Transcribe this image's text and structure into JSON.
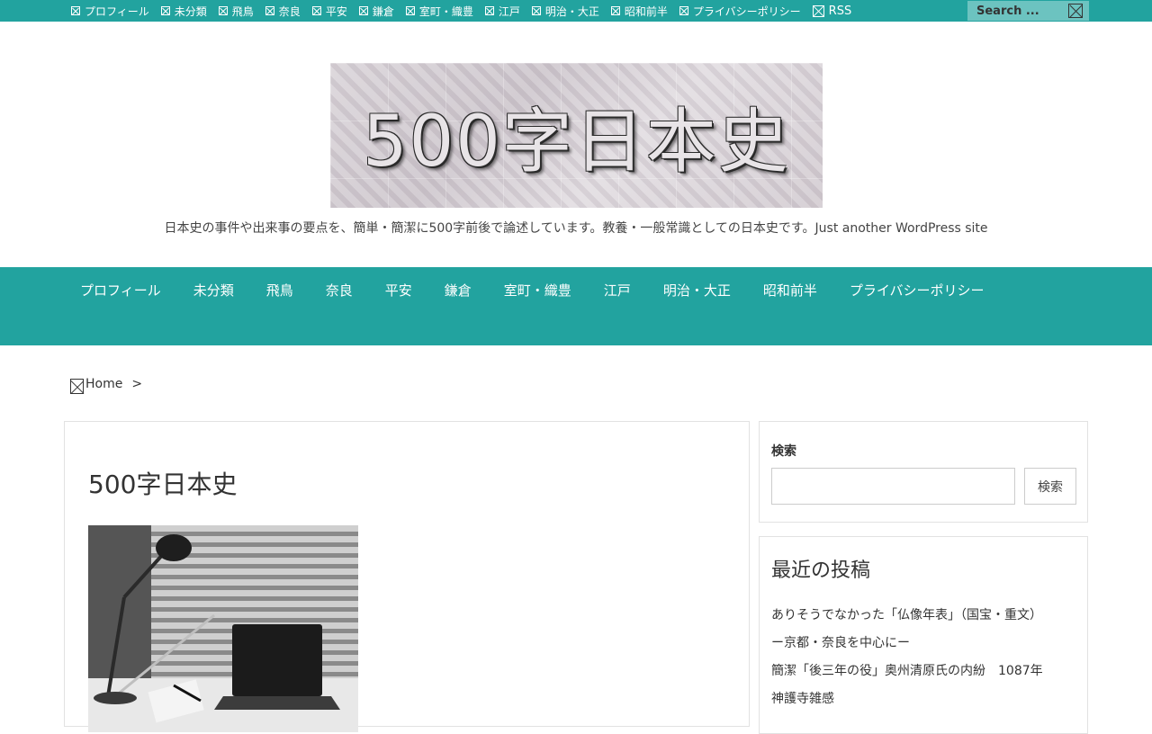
{
  "topbar": {
    "nav": [
      "プロフィール",
      "未分類",
      "飛鳥",
      "奈良",
      "平安",
      "鎌倉",
      "室町・織豊",
      "江戸",
      "明治・大正",
      "昭和前半",
      "プライバシーポリシー"
    ],
    "rss_label": "RSS",
    "search_placeholder": "Search ..."
  },
  "header": {
    "logo_text": "500字日本史",
    "tagline": "日本史の事件や出来事の要点を、簡単・簡潔に500字前後で論述しています。教養・一般常識としての日本史です。Just another WordPress site"
  },
  "mainnav": [
    "プロフィール",
    "未分類",
    "飛鳥",
    "奈良",
    "平安",
    "鎌倉",
    "室町・織豊",
    "江戸",
    "明治・大正",
    "昭和前半",
    "プライバシーポリシー"
  ],
  "breadcrumb": {
    "home": "Home",
    "separator": ">"
  },
  "post": {
    "title": "500字日本史"
  },
  "sidebar": {
    "search_label": "検索",
    "search_button": "検索",
    "recent_title": "最近の投稿",
    "recent_posts": [
      "ありそうでなかった「仏像年表」（国宝・重文）",
      "ー京都・奈良を中心にー",
      "簡潔「後三年の役」奥州清原氏の内紛　1087年",
      "神護寺雑感"
    ]
  },
  "colors": {
    "accent": "#22a39f",
    "search_bg": "#6cc3c0"
  }
}
